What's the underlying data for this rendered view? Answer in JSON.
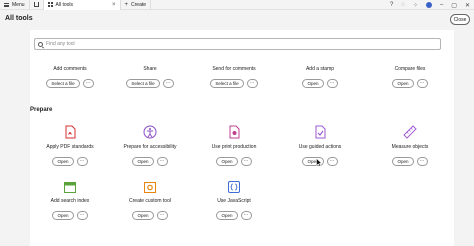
{
  "topbar": {
    "menu_label": "Menu",
    "active_tab_label": "All tools",
    "create_label": "Create"
  },
  "header": {
    "title": "All tools",
    "close_label": "Close"
  },
  "search": {
    "placeholder": "Find any tool"
  },
  "section": {
    "prepare_title": "Prepare"
  },
  "row_top": [
    {
      "label": "Add comments",
      "button": "Select a file"
    },
    {
      "label": "Share",
      "button": "Select a file"
    },
    {
      "label": "Send for comments",
      "button": "Select a file"
    },
    {
      "label": "Add a stamp",
      "button": "Open"
    },
    {
      "label": "Compare files",
      "button": "Open"
    }
  ],
  "row_prepare_1": [
    {
      "label": "Apply PDF standards",
      "button": "Open"
    },
    {
      "label": "Prepare for accessibility",
      "button": "Open"
    },
    {
      "label": "Use print production",
      "button": "Open"
    },
    {
      "label": "Use guided actions",
      "button": "Open"
    },
    {
      "label": "Measure objects",
      "button": "Open"
    }
  ],
  "row_prepare_2": [
    {
      "label": "Add search index",
      "button": "Open"
    },
    {
      "label": "Create custom tool",
      "button": "Open"
    },
    {
      "label": "Use JavaScript",
      "button": "Open"
    }
  ],
  "more_label": "···",
  "colors": {
    "pdf_red": "#d6302f",
    "access_purple": "#8a4fc5",
    "print_pink": "#c0408f",
    "guided_purple": "#9b59d0",
    "measure_purple": "#a25fd6",
    "search_green": "#5aa33b",
    "custom_orange": "#e8850f",
    "js_blue": "#3d6dd6"
  }
}
